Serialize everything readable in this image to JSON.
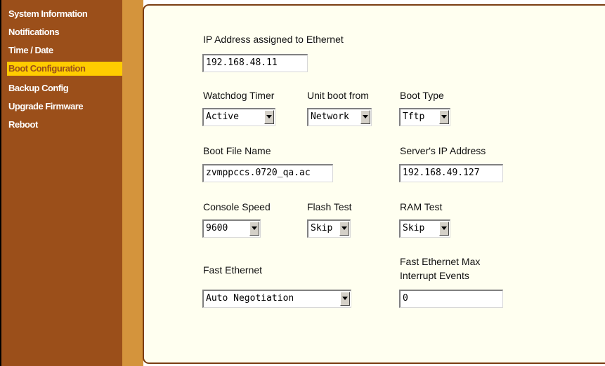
{
  "sidebar": {
    "items": [
      {
        "label": "System Information"
      },
      {
        "label": "Notifications"
      },
      {
        "label": "Time / Date"
      },
      {
        "label": "Boot Configuration"
      },
      {
        "label": "Backup Config"
      },
      {
        "label": "Upgrade Firmware"
      },
      {
        "label": "Reboot"
      }
    ],
    "active_index": 3
  },
  "form": {
    "ip_address": {
      "label": "IP Address assigned to Ethernet",
      "value": "192.168.48.11"
    },
    "watchdog_timer": {
      "label": "Watchdog Timer",
      "selected": "Active"
    },
    "unit_boot_from": {
      "label": "Unit boot from",
      "selected": "Network"
    },
    "boot_type": {
      "label": "Boot Type",
      "selected": "Tftp"
    },
    "boot_file_name": {
      "label": "Boot File Name",
      "value": "zvmppccs.0720_qa.ac"
    },
    "server_ip": {
      "label": "Server's IP Address",
      "value": "192.168.49.127"
    },
    "console_speed": {
      "label": "Console Speed",
      "selected": "9600"
    },
    "flash_test": {
      "label": "Flash Test",
      "selected": "Skip"
    },
    "ram_test": {
      "label": "RAM Test",
      "selected": "Skip"
    },
    "fast_ethernet": {
      "label": "Fast Ethernet",
      "selected": "Auto Negotiation"
    },
    "fast_ethernet_max": {
      "label_line1": "Fast Ethernet Max",
      "label_line2": "Interrupt Events",
      "value": "0"
    }
  },
  "colors": {
    "sidebar_bg": "#9b4f1a",
    "active_bg": "#ffcc00",
    "gutter": "#d4943c",
    "panel_bg": "#fffff0"
  },
  "icons": {
    "dropdown": "chevron-down-icon"
  }
}
